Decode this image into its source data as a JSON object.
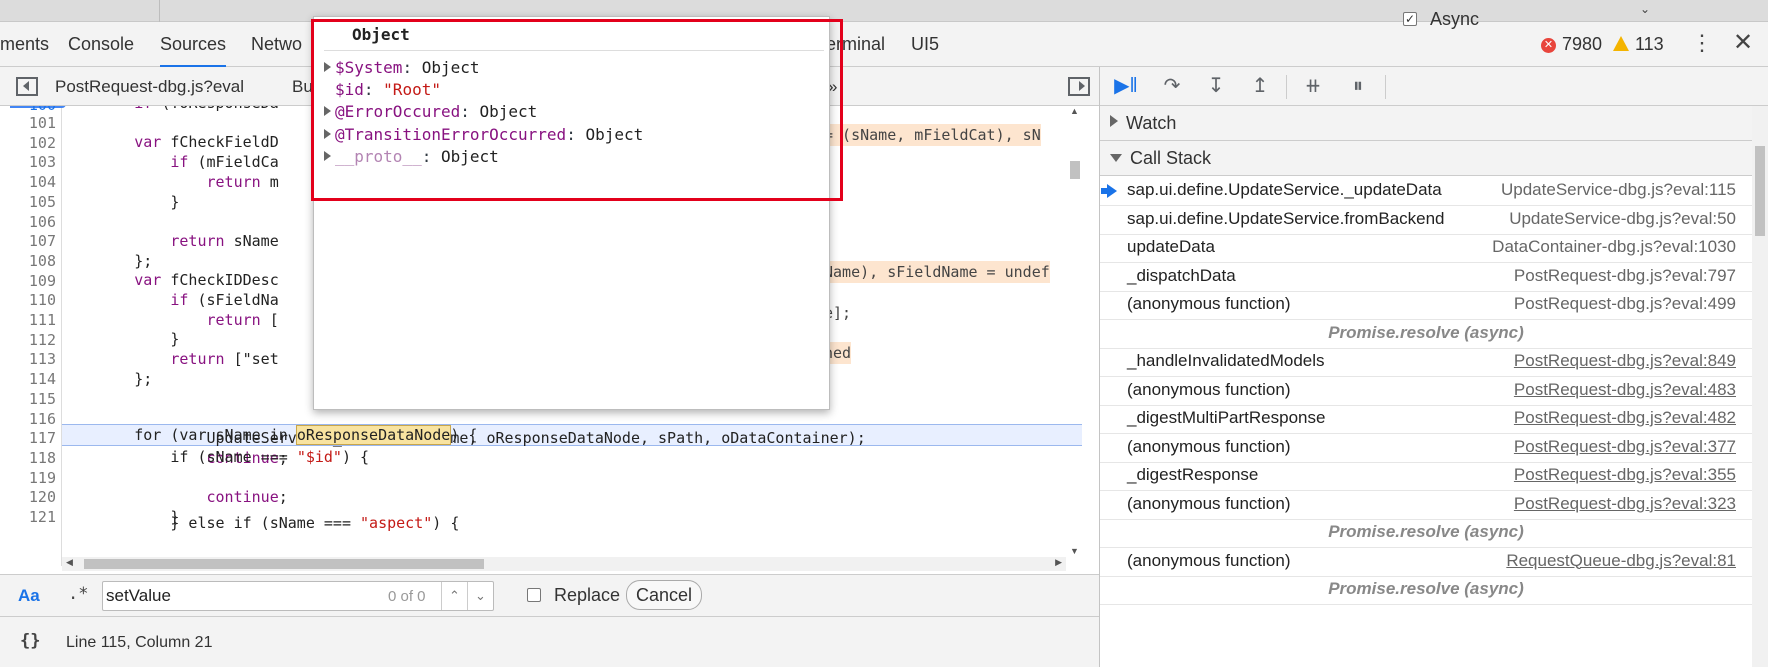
{
  "tabs": {
    "elements": "ments",
    "console": "Console",
    "sources": "Sources",
    "network": "Netwo",
    "terminal": "erminal",
    "ui5": "UI5"
  },
  "badges": {
    "errors": "7980",
    "warnings": "113"
  },
  "editor": {
    "file_tab": "PostRequest-dbg.js?eval",
    "file_tab2": "Bu",
    "more_tabs": "»",
    "gutter_cut": "100",
    "line_numbers": [
      "101",
      "102",
      "103",
      "104",
      "105",
      "106",
      "107",
      "108",
      "109",
      "110",
      "111",
      "112",
      "113",
      "114",
      "115",
      "116",
      "117",
      "118",
      "119",
      "120",
      "121"
    ],
    "lines": [
      {
        "t": "        if (!oResponseDa"
      },
      {
        "t": ""
      },
      {
        "t": "        var fCheckFieldD"
      },
      {
        "t": "            if (mFieldCa"
      },
      {
        "t": "                return m"
      },
      {
        "t": "            }"
      },
      {
        "t": ""
      },
      {
        "t": "            return sName"
      },
      {
        "t": "        };"
      },
      {
        "t": "        var fCheckIDDesc"
      },
      {
        "t": "            if (sFieldNa"
      },
      {
        "t": "                return ["
      },
      {
        "t": "            }"
      },
      {
        "t": "            return [\"set"
      },
      {
        "t": "        };"
      },
      {
        "t": ""
      },
      {
        "t": "            if (sName === "
      },
      {
        "t": "                UpdateService._handleId(sName, oResponseDataNode, sPath, oDataContainer);"
      },
      {
        "t": "                continue;"
      },
      {
        "t": "            } else if (sName === "
      },
      {
        "t": "                continue;"
      },
      {
        "t": "            }"
      }
    ],
    "line115_pre": "        for (var sName in ",
    "line115_hl": "oResponseDataNode",
    "line115_post": ") {",
    "str_id": "\"$id\"",
    "str_aspect": "\"aspect\"",
    "line116_post": ") {",
    "line119_post": ") {",
    "inline_102": "= (sName, mFieldCat), sN",
    "inline_109": "Name), sFieldName = undef",
    "inline_111": "e];",
    "inline_113": "ned"
  },
  "search": {
    "case_btn": "Aa",
    "regex_btn": ".*",
    "value": "setValue",
    "count": "0 of 0",
    "replace_label": "Replace",
    "cancel_label": "Cancel"
  },
  "status": {
    "pretty": "{}",
    "cursor": "Line 115, Column 21"
  },
  "debugger": {
    "async_label": "Async",
    "watch_label": "Watch",
    "callstack_label": "Call Stack",
    "frames": [
      {
        "fn": "sap.ui.define.UpdateService._updateData",
        "loc": "UpdateService-dbg.js?eval:115"
      },
      {
        "fn": "sap.ui.define.UpdateService.fromBackend",
        "loc": "UpdateService-dbg.js?eval:50"
      },
      {
        "fn": "updateData",
        "loc": "DataContainer-dbg.js?eval:1030"
      },
      {
        "fn": "_dispatchData",
        "loc": "PostRequest-dbg.js?eval:797"
      },
      {
        "fn": "(anonymous function)",
        "loc": "PostRequest-dbg.js?eval:499"
      },
      {
        "async": "Promise.resolve (async)"
      },
      {
        "fn": "_handleInvalidatedModels",
        "loc": "PostRequest-dbg.js?eval:849"
      },
      {
        "fn": "(anonymous function)",
        "loc": "PostRequest-dbg.js?eval:483"
      },
      {
        "fn": "_digestMultiPartResponse",
        "loc": "PostRequest-dbg.js?eval:482"
      },
      {
        "fn": "(anonymous function)",
        "loc": "PostRequest-dbg.js?eval:377"
      },
      {
        "fn": "_digestResponse",
        "loc": "PostRequest-dbg.js?eval:355"
      },
      {
        "fn": "(anonymous function)",
        "loc": "PostRequest-dbg.js?eval:323"
      },
      {
        "async": "Promise.resolve (async)"
      },
      {
        "fn": "(anonymous function)",
        "loc": "RequestQueue-dbg.js?eval:81"
      },
      {
        "async": "Promise.resolve (async)"
      }
    ]
  },
  "popover": {
    "title": "Object",
    "props": [
      {
        "name": "$System",
        "value": "Object",
        "expandable": true
      },
      {
        "name": "$id",
        "value": "\"Root\"",
        "expandable": false,
        "string": true
      },
      {
        "name": "@ErrorOccured",
        "value": "Object",
        "expandable": true
      },
      {
        "name": "@TransitionErrorOccurred",
        "value": "Object",
        "expandable": true
      },
      {
        "name": "__proto__",
        "value": "Object",
        "expandable": true,
        "dim": true
      }
    ]
  },
  "colors": {
    "accent": "#1a73e8",
    "highlight_border": "#e3001b",
    "keyword": "#881280",
    "string": "#c41a16"
  }
}
